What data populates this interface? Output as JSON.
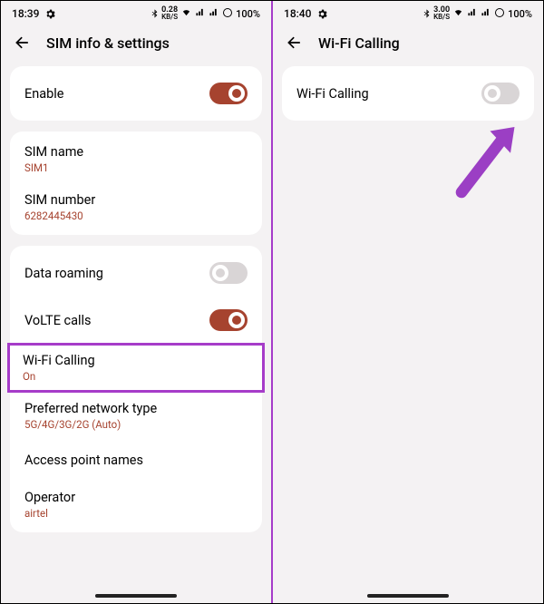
{
  "left": {
    "status": {
      "time": "18:39",
      "kbps": "0.28",
      "battery": "100%"
    },
    "header": {
      "title": "SIM info & settings"
    },
    "enable": {
      "label": "Enable",
      "on": true
    },
    "sim": {
      "name_label": "SIM name",
      "name_value": "SIM1",
      "number_label": "SIM number",
      "number_value": "6282445430"
    },
    "settings": {
      "data_roaming": {
        "label": "Data roaming",
        "on": false
      },
      "volte": {
        "label": "VoLTE calls",
        "on": true
      },
      "wifi_calling": {
        "label": "Wi-Fi Calling",
        "sub": "On"
      },
      "pref_net": {
        "label": "Preferred network type",
        "sub": "5G/4G/3G/2G (Auto)"
      },
      "apn": {
        "label": "Access point names"
      },
      "operator": {
        "label": "Operator",
        "sub": "airtel"
      }
    }
  },
  "right": {
    "status": {
      "time": "18:40",
      "kbps": "3.00",
      "battery": "100%"
    },
    "header": {
      "title": "Wi-Fi Calling"
    },
    "wifi_calling": {
      "label": "Wi-Fi Calling",
      "on": false
    }
  }
}
